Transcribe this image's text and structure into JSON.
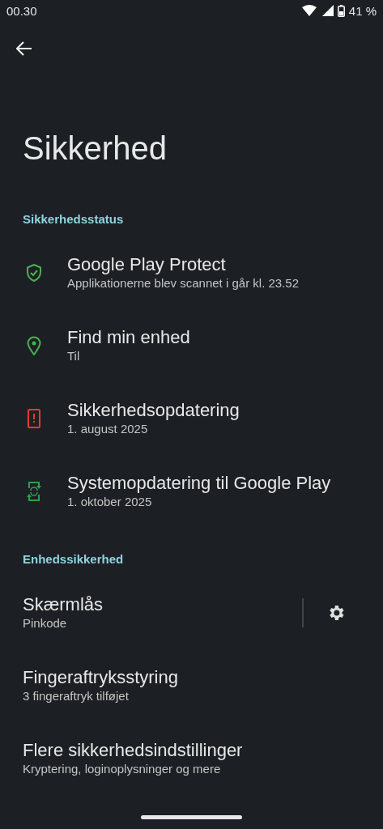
{
  "status_bar": {
    "time": "00.30",
    "battery": "41 %"
  },
  "title": "Sikkerhed",
  "sections": [
    {
      "header": "Sikkerhedsstatus",
      "items": [
        {
          "kind": "shield",
          "color": "#4caf50",
          "title": "Google Play Protect",
          "subtitle": "Applikationerne blev scannet i går kl. 23.52"
        },
        {
          "kind": "pin",
          "color": "#4caf50",
          "title": "Find min enhed",
          "subtitle": "Til"
        },
        {
          "kind": "phone-alert",
          "color": "#e53935",
          "title": "Sikkerhedsopdatering",
          "subtitle": "1. august 2025"
        },
        {
          "kind": "phone-sync",
          "color": "#2e9e4f",
          "title": "Systemopdatering til Google Play",
          "subtitle": "1. oktober 2025"
        }
      ]
    },
    {
      "header": "Enhedssikkerhed",
      "items": [
        {
          "kind": "settings",
          "title": "Skærmlås",
          "subtitle": "Pinkode"
        },
        {
          "kind": "plain",
          "title": "Fingeraftryksstyring",
          "subtitle": "3 fingeraftryk tilføjet"
        },
        {
          "kind": "plain",
          "title": "Flere sikkerhedsindstillinger",
          "subtitle": "Kryptering, loginoplysninger og mere"
        }
      ]
    }
  ]
}
